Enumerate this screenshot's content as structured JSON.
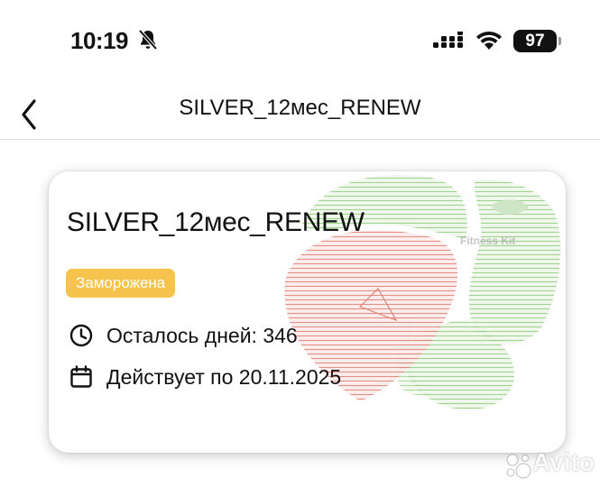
{
  "status_bar": {
    "time": "10:19",
    "battery": "97",
    "icons": [
      "bell-slash-icon",
      "signal-icon",
      "wifi-icon",
      "battery-icon"
    ]
  },
  "nav": {
    "title": "SILVER_12мес_RENEW",
    "back_icon": "chevron-left-icon"
  },
  "card": {
    "title": "SILVER_12мес_RENEW",
    "status_badge": "Заморожена",
    "days_left": "Осталось дней: 346",
    "valid_until": "Действует по 20.11.2025",
    "logo_text": "Fitness Kit"
  },
  "watermark": {
    "text": "Avito"
  },
  "colors": {
    "badge": "#f6c44d",
    "logo_green": "#7cc06a",
    "logo_red": "#d86b62",
    "text": "#111111"
  }
}
